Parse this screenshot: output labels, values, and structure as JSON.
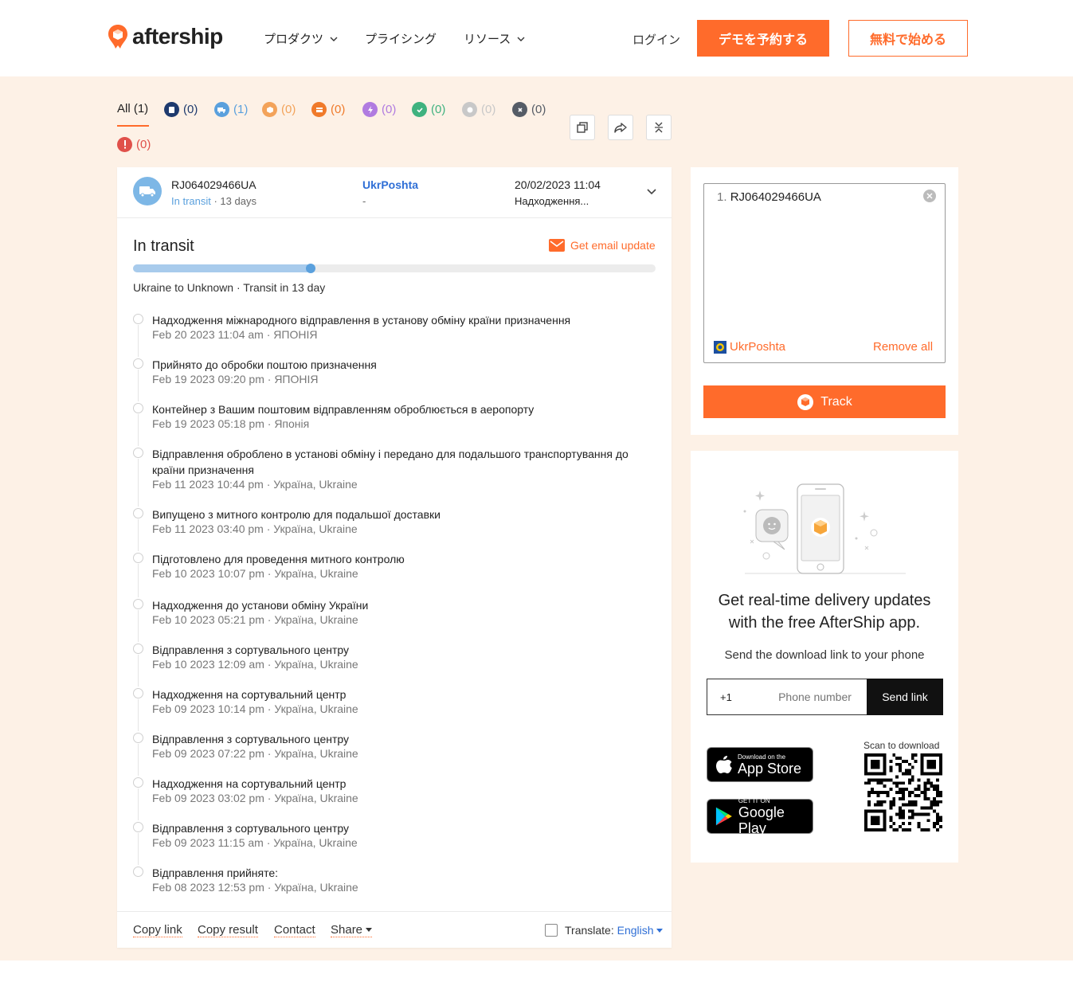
{
  "header": {
    "brand": "aftership",
    "nav": [
      {
        "label": "プロダクツ",
        "dropdown": true
      },
      {
        "label": "プライシング",
        "dropdown": false
      },
      {
        "label": "リソース",
        "dropdown": true
      }
    ],
    "login": "ログイン",
    "demo_button": "デモを予約する",
    "free_button": "無料で始める",
    "accent": "#ff6b2b"
  },
  "filters": {
    "all": "All (1)",
    "tabs": [
      {
        "icon": "info-received-icon",
        "count": "(0)",
        "color": "#1e3a6e"
      },
      {
        "icon": "in-transit-icon",
        "count": "(1)",
        "color": "#5aa0dd"
      },
      {
        "icon": "out-for-delivery-icon",
        "count": "(0)",
        "color": "#f3a35a"
      },
      {
        "icon": "available-for-pickup-icon",
        "count": "(0)",
        "color": "#f07a2a"
      },
      {
        "icon": "failed-attempt-icon",
        "count": "(0)",
        "color": "#b07be0"
      },
      {
        "icon": "delivered-icon",
        "count": "(0)",
        "color": "#3fb27f"
      },
      {
        "icon": "pending-icon",
        "count": "(0)",
        "color": "#c8c8c8"
      },
      {
        "icon": "expired-icon",
        "count": "(0)",
        "color": "#555c66"
      },
      {
        "icon": "exception-icon",
        "count": "(0)",
        "color": "#e0504a"
      }
    ]
  },
  "shipment": {
    "tracking_number": "RJ064029466UA",
    "status_label": "In transit",
    "status_days": " · 13 days",
    "courier": "UkrPoshta",
    "courier_sub": "-",
    "last_date": "20/02/2023 11:04",
    "last_event_short": "Надходження...",
    "status_title": "In transit",
    "email_update": "Get email update",
    "progress": 0.34,
    "route": "Ukraine to Unknown · Transit in 13 day"
  },
  "events": [
    {
      "title": "Надходження міжнародного відправлення в установу обміну країни призначення",
      "meta": "Feb 20 2023 11:04 am · ЯПОНІЯ"
    },
    {
      "title": "Прийнято до обробки поштою призначення",
      "meta": "Feb 19 2023 09:20 pm · ЯПОНІЯ"
    },
    {
      "title": "Контейнер з Вашим поштовим відправленням оброблюється в аеропорту",
      "meta": "Feb 19 2023 05:18 pm · Японія"
    },
    {
      "title": "Відправлення оброблено в установі обміну і передано для подальшого транспортування до країни призначення",
      "meta": "Feb 11 2023 10:44 pm · Україна, Ukraine"
    },
    {
      "title": "Випущено з митного контролю для подальшої доставки",
      "meta": "Feb 11 2023 03:40 pm · Україна, Ukraine"
    },
    {
      "title": "Підготовлено для проведення митного контролю",
      "meta": "Feb 10 2023 10:07 pm · Україна, Ukraine"
    },
    {
      "title": "Надходження до установи обміну України",
      "meta": "Feb 10 2023 05:21 pm · Україна, Ukraine"
    },
    {
      "title": "Відправлення з сортувального центру",
      "meta": "Feb 10 2023 12:09 am · Україна, Ukraine"
    },
    {
      "title": "Надходження на сортувальний центр",
      "meta": "Feb 09 2023 10:14 pm · Україна, Ukraine"
    },
    {
      "title": "Відправлення з сортувального центру",
      "meta": "Feb 09 2023 07:22 pm · Україна, Ukraine"
    },
    {
      "title": "Надходження на сортувальний центр",
      "meta": "Feb 09 2023 03:02 pm · Україна, Ukraine"
    },
    {
      "title": "Відправлення з сортувального центру",
      "meta": "Feb 09 2023 11:15 am · Україна, Ukraine"
    },
    {
      "title": "Відправлення прийняте:",
      "meta": "Feb 08 2023 12:53 pm · Україна, Ukraine"
    }
  ],
  "footer": {
    "copy_link": "Copy link",
    "copy_result": "Copy result",
    "contact": "Contact",
    "share": "Share",
    "translate_label": "Translate:",
    "translate_lang": "English"
  },
  "search": {
    "line_number": "1.",
    "line_value": "RJ064029466UA",
    "courier": "UkrPoshta",
    "remove_all": "Remove all",
    "track_button": "Track"
  },
  "app_promo": {
    "title_line1": "Get real-time delivery updates",
    "title_line2": "with the free AfterShip app.",
    "subtitle": "Send the download link to your phone",
    "country_code": "+1",
    "phone_placeholder": "Phone number",
    "send_button": "Send link",
    "app_store_small": "Download on the",
    "app_store_big": "App Store",
    "google_small": "GET IT ON",
    "google_big": "Google Play",
    "scan_label": "Scan to download"
  }
}
